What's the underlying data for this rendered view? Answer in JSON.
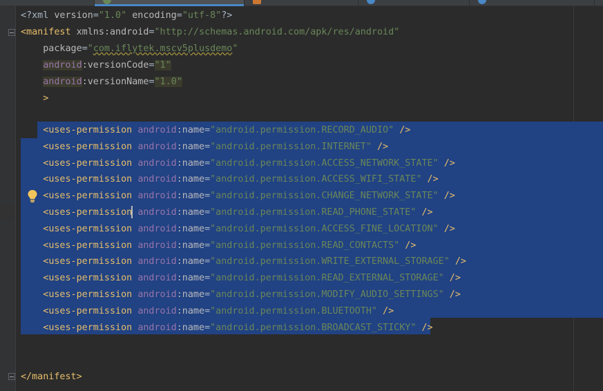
{
  "colors": {
    "background": "#2b2b2b",
    "selection": "#214283",
    "tag": "#e8bf6a",
    "namespace": "#9876aa",
    "attribute": "#bababa",
    "string_value": "#6a8759",
    "plain": "#a9b7c6",
    "tab_active_underline": "#4a88c7"
  },
  "editor": {
    "xml_decl": {
      "open": "<?xml",
      "version_attr": "version",
      "version_val": "\"1.0\"",
      "encoding_attr": "encoding",
      "encoding_val": "\"utf-8\"",
      "close": "?>"
    },
    "manifest_open": {
      "bracket": "<",
      "tag": "manifest",
      "xmlns_attr": "xmlns",
      "xmlns_ns": "android",
      "xmlns_val": "\"http://schemas.android.com/apk/res/android\""
    },
    "package_attr": "package",
    "package_val_quote": "\"",
    "package_val": "com.iflytek.mscv5plusdemo",
    "version_code_ns": "android",
    "version_code_attr": ":versionCode",
    "version_code_val": "\"1\"",
    "version_name_ns": "android",
    "version_name_attr": ":versionName",
    "version_name_val": "\"1.0\"",
    "manifest_gt": ">",
    "permission_tag": "uses-permission",
    "permission_ns": "android",
    "permission_attr": ":name",
    "permission_close": "/>",
    "permissions": [
      "\"android.permission.RECORD_AUDIO\"",
      "\"android.permission.INTERNET\"",
      "\"android.permission.ACCESS_NETWORK_STATE\"",
      "\"android.permission.ACCESS_WIFI_STATE\"",
      "\"android.permission.CHANGE_NETWORK_STATE\"",
      "\"android.permission.READ_PHONE_STATE\"",
      "\"android.permission.ACCESS_FINE_LOCATION\"",
      "\"android.permission.READ_CONTACTS\"",
      "\"android.permission.WRITE_EXTERNAL_STORAGE\"",
      "\"android.permission.READ_EXTERNAL_STORAGE\"",
      "\"android.permission.MODIFY_AUDIO_SETTINGS\"",
      "\"android.permission.BLUETOOTH\"",
      "\"android.permission.BROADCAST_STICKY\""
    ],
    "manifest_close": "</manifest>"
  }
}
